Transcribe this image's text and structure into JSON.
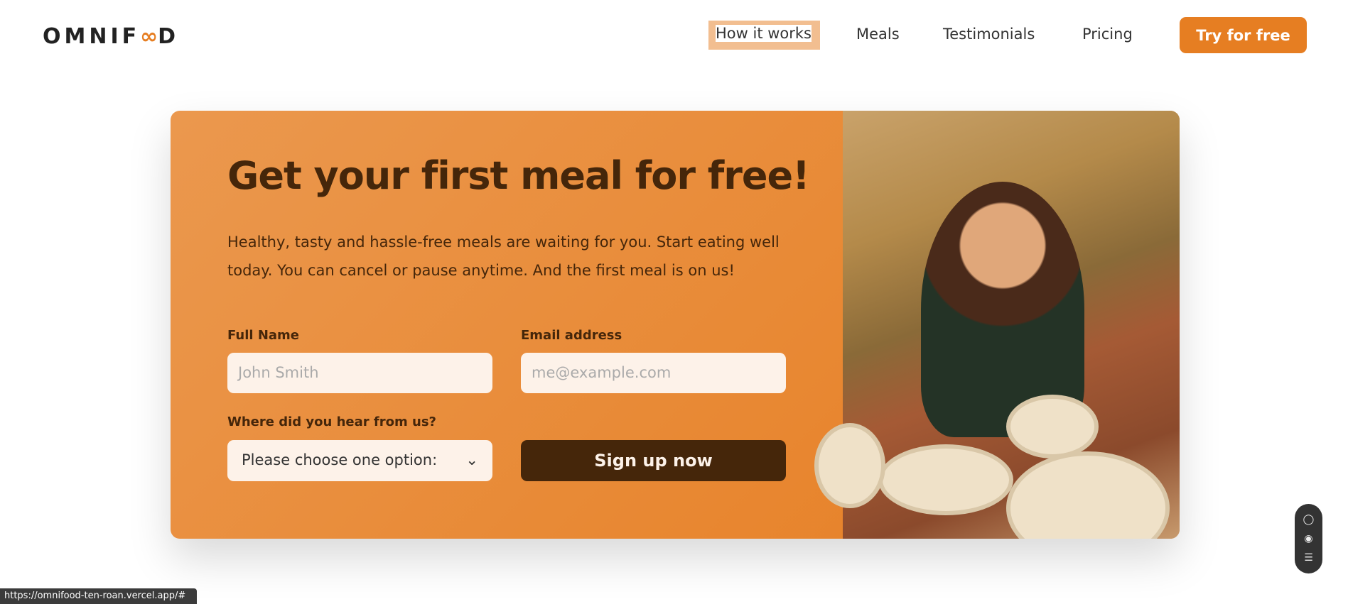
{
  "header": {
    "logo": {
      "pre": "OMNIF",
      "inf": "∞",
      "post": "D"
    },
    "nav": [
      "How it works",
      "Meals",
      "Testimonials",
      "Pricing"
    ],
    "cta": "Try for free"
  },
  "cta_section": {
    "title": "Get your first meal for free!",
    "text": "Healthy, tasty and hassle-free meals are waiting for you. Start eating well today. You can cancel or pause anytime. And the first meal is on us!",
    "full_name": {
      "label": "Full Name",
      "placeholder": "John Smith"
    },
    "email": {
      "label": "Email address",
      "placeholder": "me@example.com"
    },
    "source": {
      "label": "Where did you hear from us?",
      "value": "Please choose one option:"
    },
    "submit": "Sign up now"
  },
  "status_url": "https://omnifood-ten-roan.vercel.app/#",
  "colors": {
    "accent": "#e67e22",
    "dark": "#45260a"
  }
}
